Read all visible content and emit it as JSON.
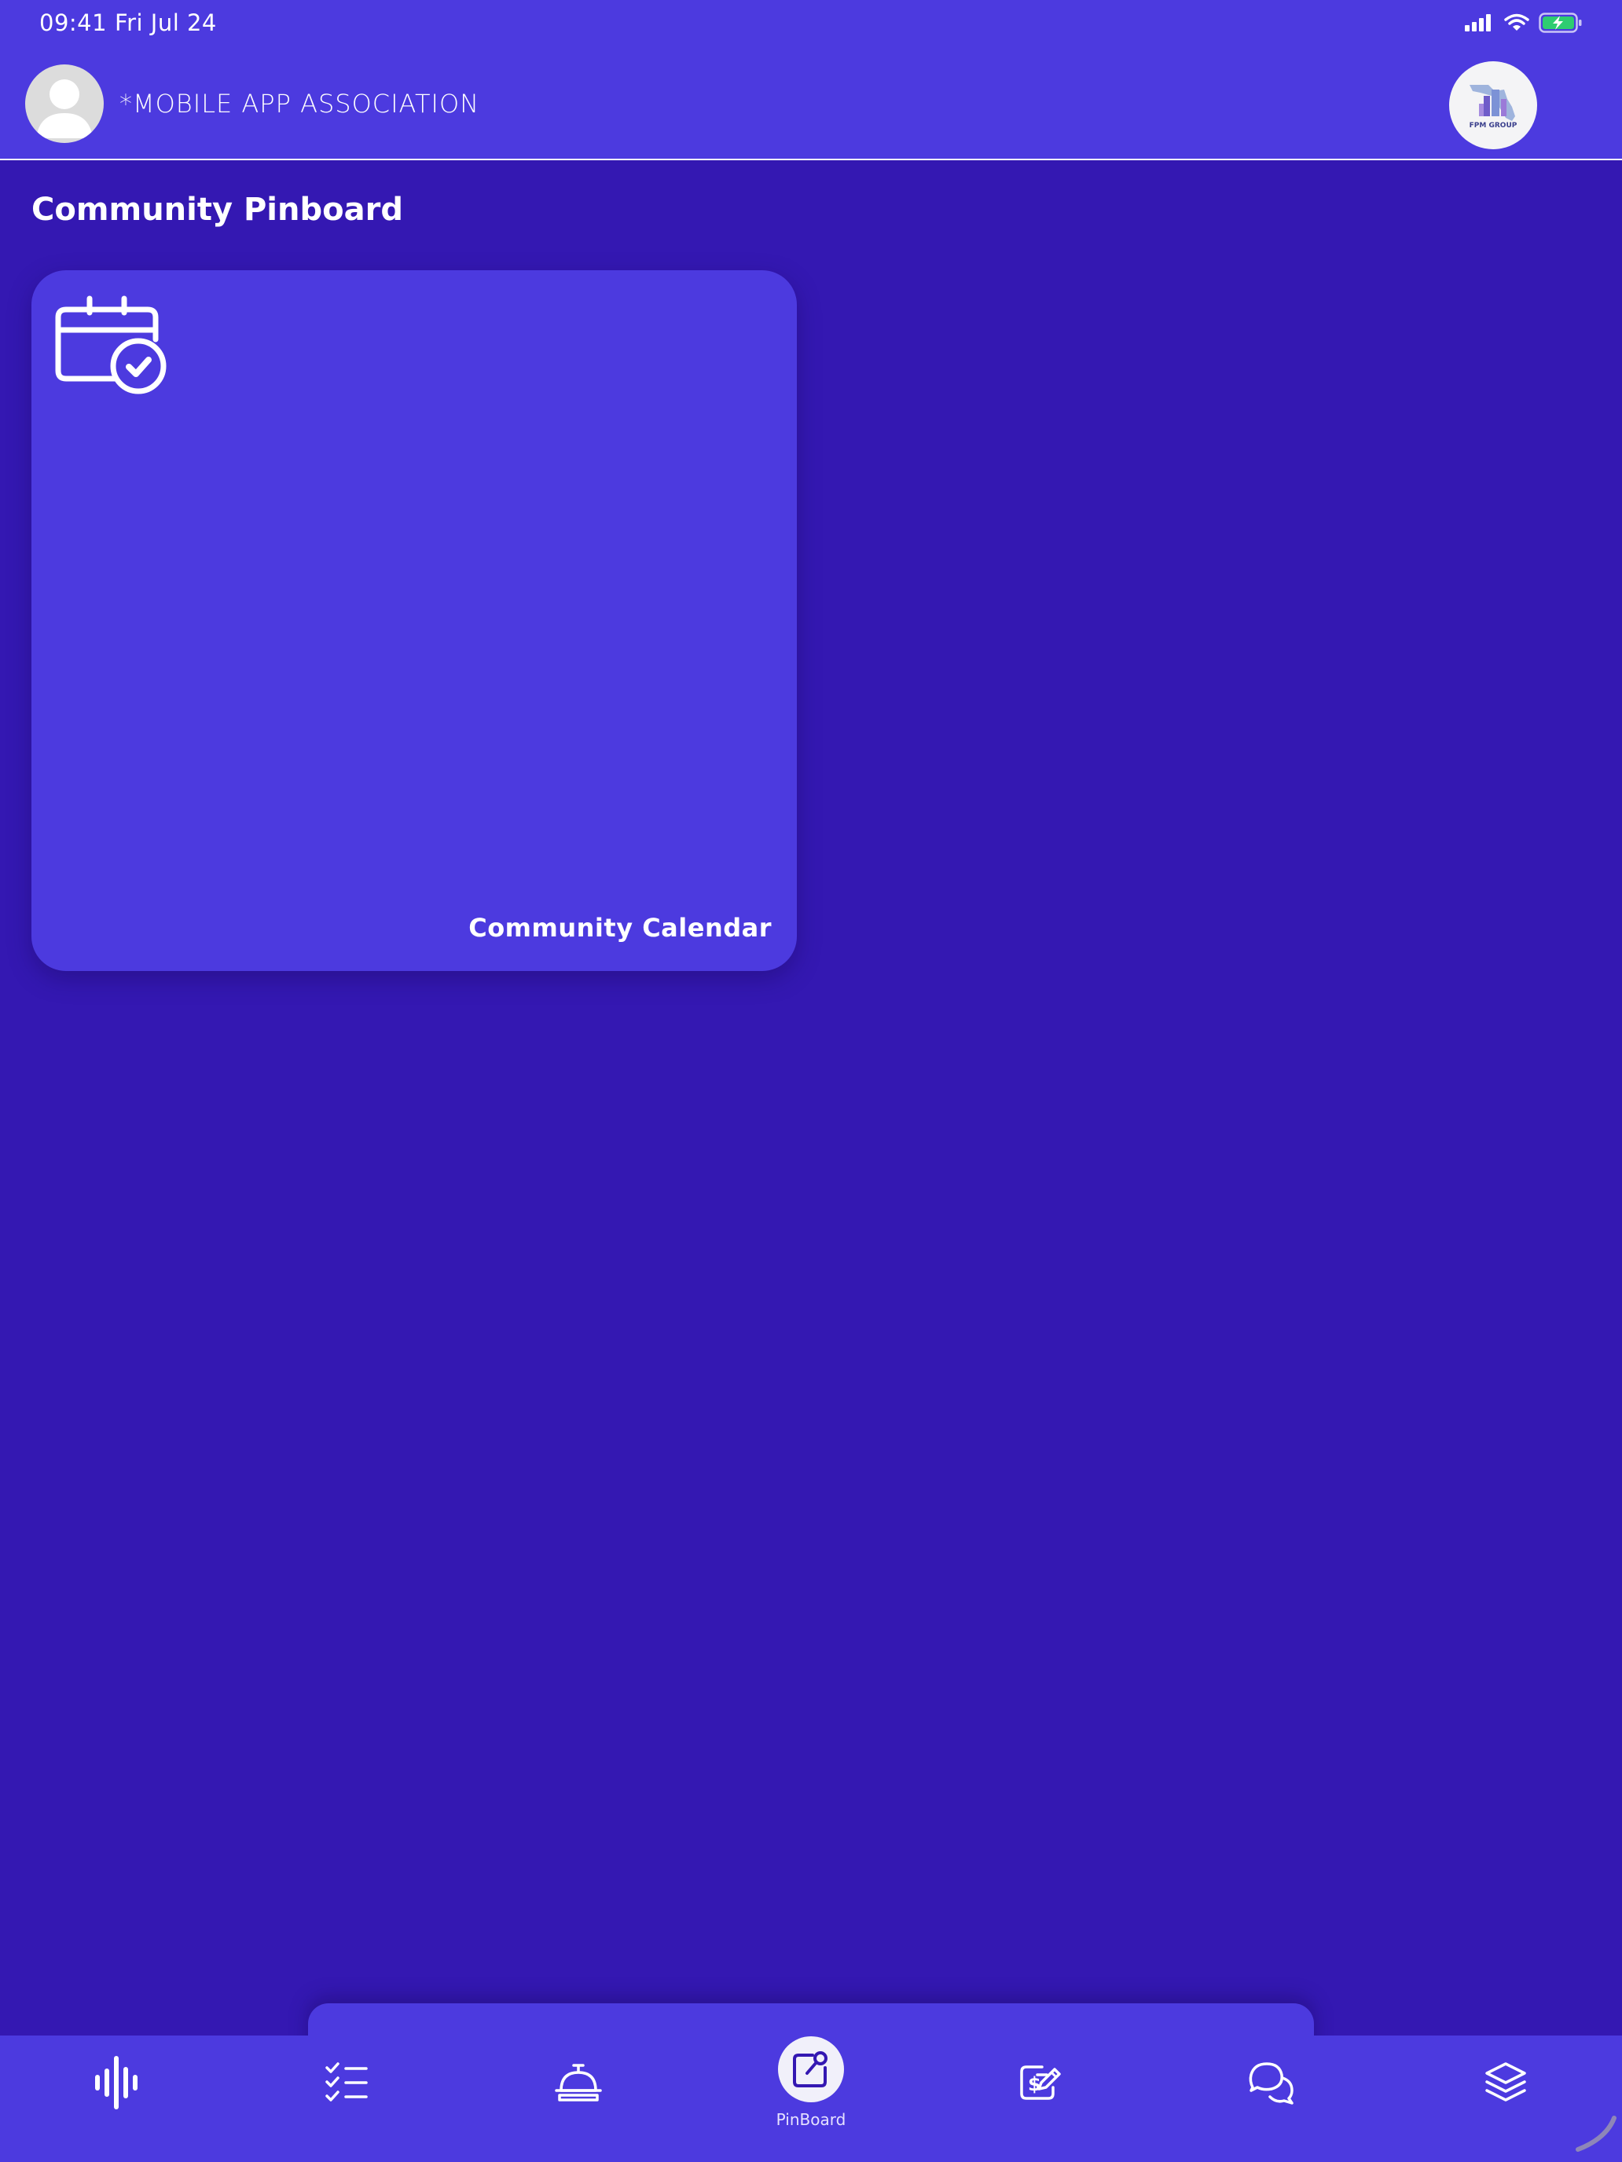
{
  "status_bar": {
    "time": "09:41",
    "date": "Fri Jul 24"
  },
  "header": {
    "association_name": "*MOBILE APP ASSOCIATION",
    "logo_text": "FPM GROUP"
  },
  "page": {
    "title": "Community Pinboard"
  },
  "cards": [
    {
      "label": "Community Calendar",
      "icon": "calendar-check-icon"
    }
  ],
  "tabbar": {
    "tabs": [
      {
        "name": "audio-wave",
        "icon": "audio-wave-icon"
      },
      {
        "name": "checklist",
        "icon": "checklist-icon"
      },
      {
        "name": "service-bell",
        "icon": "service-bell-icon"
      },
      {
        "name": "pinboard",
        "icon": "pinboard-icon",
        "label": "PinBoard",
        "active": true
      },
      {
        "name": "payments",
        "icon": "payment-edit-icon"
      },
      {
        "name": "messages",
        "icon": "chat-bubbles-icon"
      },
      {
        "name": "documents",
        "icon": "layers-icon"
      }
    ]
  },
  "colors": {
    "background": "#3418B2",
    "surface": "#4C3ADF",
    "text": "#FFFFFF",
    "active_tab_circle": "#F1F0FA",
    "battery_green": "#2ECC71"
  }
}
